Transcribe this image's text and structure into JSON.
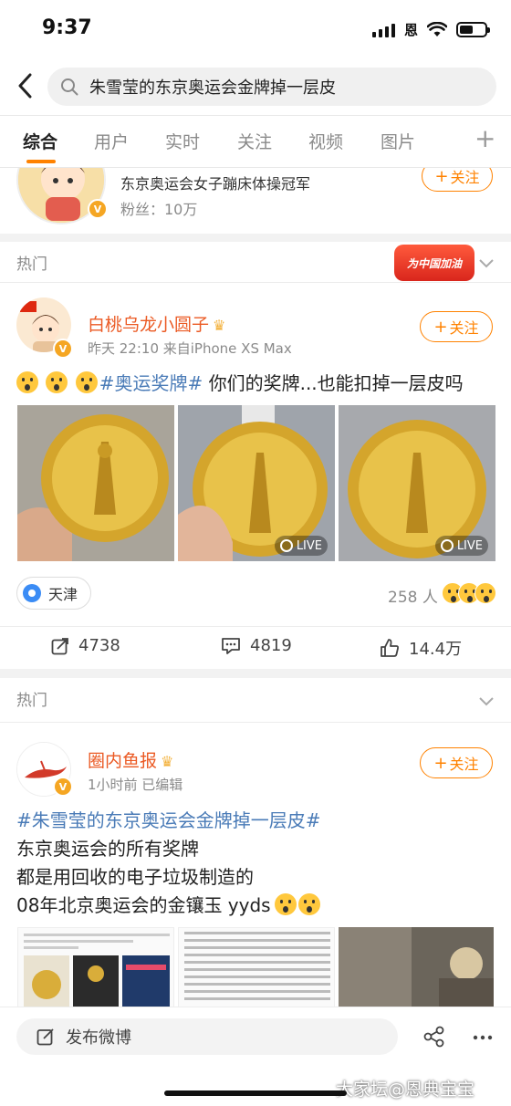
{
  "status_bar": {
    "time": "9:37",
    "carrier": "恩"
  },
  "search": {
    "query": "朱雪莹的东京奥运会金牌掉一层皮"
  },
  "tabs": [
    {
      "label": "综合",
      "active": true
    },
    {
      "label": "用户"
    },
    {
      "label": "实时"
    },
    {
      "label": "关注"
    },
    {
      "label": "视频"
    },
    {
      "label": "图片"
    }
  ],
  "tabs_more": "+",
  "user_card": {
    "description": "东京奥运会女子蹦床体操冠军",
    "fans": "粉丝：10万",
    "follow_label": "关注"
  },
  "post1": {
    "section_label": "热门",
    "promo_text": "为中国加油",
    "author": "白桃乌龙小圆子",
    "meta": "昨天 22:10  来自iPhone XS Max",
    "follow_label": "关注",
    "hashtag": "#奥运奖牌#",
    "text": " 你们的奖牌...也能扣掉一层皮吗",
    "live_label": "LIVE",
    "location": "天津",
    "reactions": "258 人",
    "reposts": "4738",
    "comments": "4819",
    "likes": "14.4万"
  },
  "post2": {
    "section_label": "热门",
    "author": "圈内鱼报",
    "meta": "1小时前    已编辑",
    "follow_label": "关注",
    "hashtag": "#朱雪莹的东京奥运会金牌掉一层皮#",
    "line1": "东京奥运会的所有奖牌",
    "line2": "都是用回收的电子垃圾制造的",
    "line3": "08年北京奥运会的金镶玉 yyds"
  },
  "bottom": {
    "compose_label": "发布微博",
    "watermark": "大家坛@恩典宝宝"
  },
  "colors": {
    "accent": "#ff8200",
    "name": "#eb5a24",
    "hashtag": "#4a7bb7"
  }
}
